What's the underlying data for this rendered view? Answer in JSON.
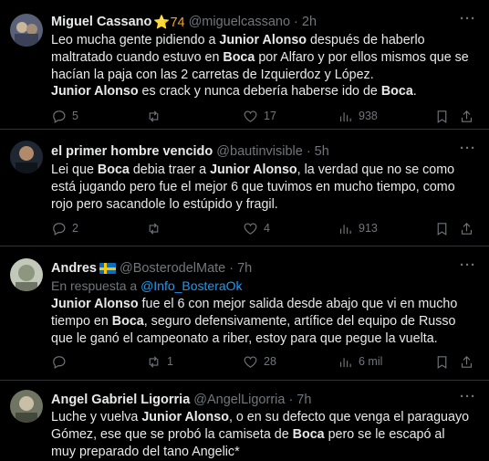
{
  "tweets": [
    {
      "name": "Miguel Cassano",
      "name_badge": "⭐74",
      "handle": "@miguelcassano",
      "time": "2h",
      "reply_to_prefix": "",
      "reply_to_handle": "",
      "body_html": "Leo mucha gente pidiendo a <b>Junior Alonso</b> después de haberlo maltratado cuando estuvo en <b>Boca</b> por Alfaro y por ellos mismos que se hacían la paja con las 2 carretas de Izquierdoz y López.<br><b>Junior Alonso</b> es crack y nunca debería haberse ido de <b>Boca</b>.",
      "replies": "5",
      "retweets": "",
      "likes": "17",
      "views": "938",
      "avatar_color": "#6a6e8a"
    },
    {
      "name": "el primer hombre vencido",
      "name_badge": "",
      "handle": "@bautinvisible",
      "time": "5h",
      "reply_to_prefix": "",
      "reply_to_handle": "",
      "body_html": "Lei que <b>Boca</b> debia traer a <b>Junior Alonso</b>, la verdad que no se como está jugando pero fue el mejor 6 que tuvimos en mucho tiempo, como rojo pero sacandole lo estúpido y fragil.",
      "replies": "2",
      "retweets": "",
      "likes": "4",
      "views": "913",
      "avatar_color": "#2b3340"
    },
    {
      "name": "Andres",
      "name_badge": "",
      "handle": "@BosterodelMate",
      "time": "7h",
      "reply_to_prefix": "En respuesta a",
      "reply_to_handle": "@Info_BosteraOk",
      "body_html": "<b>Junior Alonso</b> fue el 6 con mejor salida desde abajo que vi en mucho tiempo en <b>Boca</b>, seguro defensivamente, artífice del equipo de Russo que le ganó el campeonato a riber, estoy para que pegue la vuelta.",
      "replies": "",
      "retweets": "1",
      "likes": "28",
      "views": "6 mil",
      "avatar_color": "#a9b3a0"
    },
    {
      "name": "Angel Gabriel Ligorria",
      "name_badge": "",
      "handle": "@AngelLigorria",
      "time": "7h",
      "reply_to_prefix": "",
      "reply_to_handle": "",
      "body_html": "Luche y vuelva <b>Junior Alonso</b>, o en su defecto que venga el paraguayo Gómez, ese que se probó la camiseta de <b>Boca</b> pero se le escapó al muy preparado del tano Angelic*",
      "replies": "",
      "retweets": "",
      "likes": "",
      "views": "",
      "avatar_color": "#8c8f7c"
    }
  ],
  "icons": {
    "reply": "reply-icon",
    "retweet": "retweet-icon",
    "like": "heart-icon",
    "views": "views-icon",
    "bookmark": "bookmark-icon",
    "share": "share-icon",
    "more": "more-icon"
  },
  "colors": {
    "background": "#000000",
    "text": "#e7e9ea",
    "muted": "#71767b",
    "link": "#1d9bf0",
    "divider": "#2f3336"
  }
}
